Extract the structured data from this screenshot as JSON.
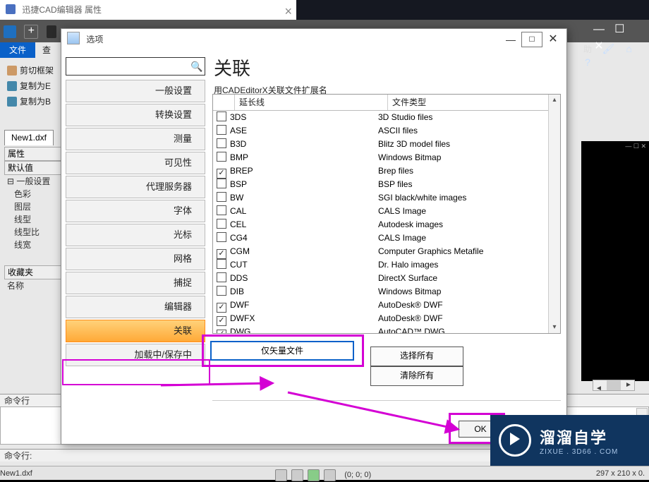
{
  "app": {
    "title": "迅捷CAD编辑器 属性",
    "file_tab": "文件",
    "tab_cha": "查",
    "lt_items": [
      "剪切框架",
      "复制为E",
      "复制为B"
    ],
    "open_file_tab": "New1.dxf",
    "help_label": "助"
  },
  "props": {
    "header1": "属性",
    "header2": "默认值",
    "group": "一般设置",
    "rows": [
      "色彩",
      "图层",
      "线型",
      "线型比",
      "线宽"
    ],
    "fav": "收藏夹",
    "name": "名称"
  },
  "cmd": {
    "label": "命令行",
    "prompt": "命令行:"
  },
  "dialog": {
    "title": "选项",
    "heading": "关联",
    "subtitle": "用CADEditorX关联文件扩展名",
    "search_placeholder": "",
    "categories": [
      "一般设置",
      "转换设置",
      "测量",
      "可见性",
      "代理服务器",
      "字体",
      "光标",
      "网格",
      "捕捉",
      "编辑器",
      "关联",
      "加载中/保存中"
    ],
    "selected_index": 10,
    "table": {
      "col_ext": "延长线",
      "col_type": "文件类型",
      "rows": [
        {
          "chk": false,
          "ext": "3DS",
          "type": "3D Studio files"
        },
        {
          "chk": false,
          "ext": "ASE",
          "type": "ASCII files"
        },
        {
          "chk": false,
          "ext": "B3D",
          "type": "Blitz 3D model files"
        },
        {
          "chk": false,
          "ext": "BMP",
          "type": "Windows Bitmap"
        },
        {
          "chk": true,
          "ext": "BREP",
          "type": "Brep files"
        },
        {
          "chk": false,
          "ext": "BSP",
          "type": "BSP files"
        },
        {
          "chk": false,
          "ext": "BW",
          "type": "SGI black/white images"
        },
        {
          "chk": false,
          "ext": "CAL",
          "type": "CALS Image"
        },
        {
          "chk": false,
          "ext": "CEL",
          "type": "Autodesk images"
        },
        {
          "chk": false,
          "ext": "CG4",
          "type": "CALS Image"
        },
        {
          "chk": true,
          "ext": "CGM",
          "type": "Computer Graphics Metafile"
        },
        {
          "chk": false,
          "ext": "CUT",
          "type": "Dr. Halo images"
        },
        {
          "chk": false,
          "ext": "DDS",
          "type": "DirectX Surface"
        },
        {
          "chk": false,
          "ext": "DIB",
          "type": "Windows Bitmap"
        },
        {
          "chk": true,
          "ext": "DWF",
          "type": "AutoDesk® DWF"
        },
        {
          "chk": true,
          "ext": "DWFX",
          "type": "AutoDesk® DWF"
        },
        {
          "chk": true,
          "ext": "DWG",
          "type": "AutoCAD™ DWG"
        }
      ]
    },
    "btn_vector": "仅矢量文件",
    "btn_select_all": "选择所有",
    "btn_clear_all": "清除所有",
    "btn_ok": "OK"
  },
  "status": {
    "file": "New1.dxf",
    "coords": "(0; 0; 0)",
    "dims": "297 x 210 x 0."
  },
  "watermark": {
    "t1": "溜溜自学",
    "t2": "ZIXUE . 3D66 . COM"
  }
}
